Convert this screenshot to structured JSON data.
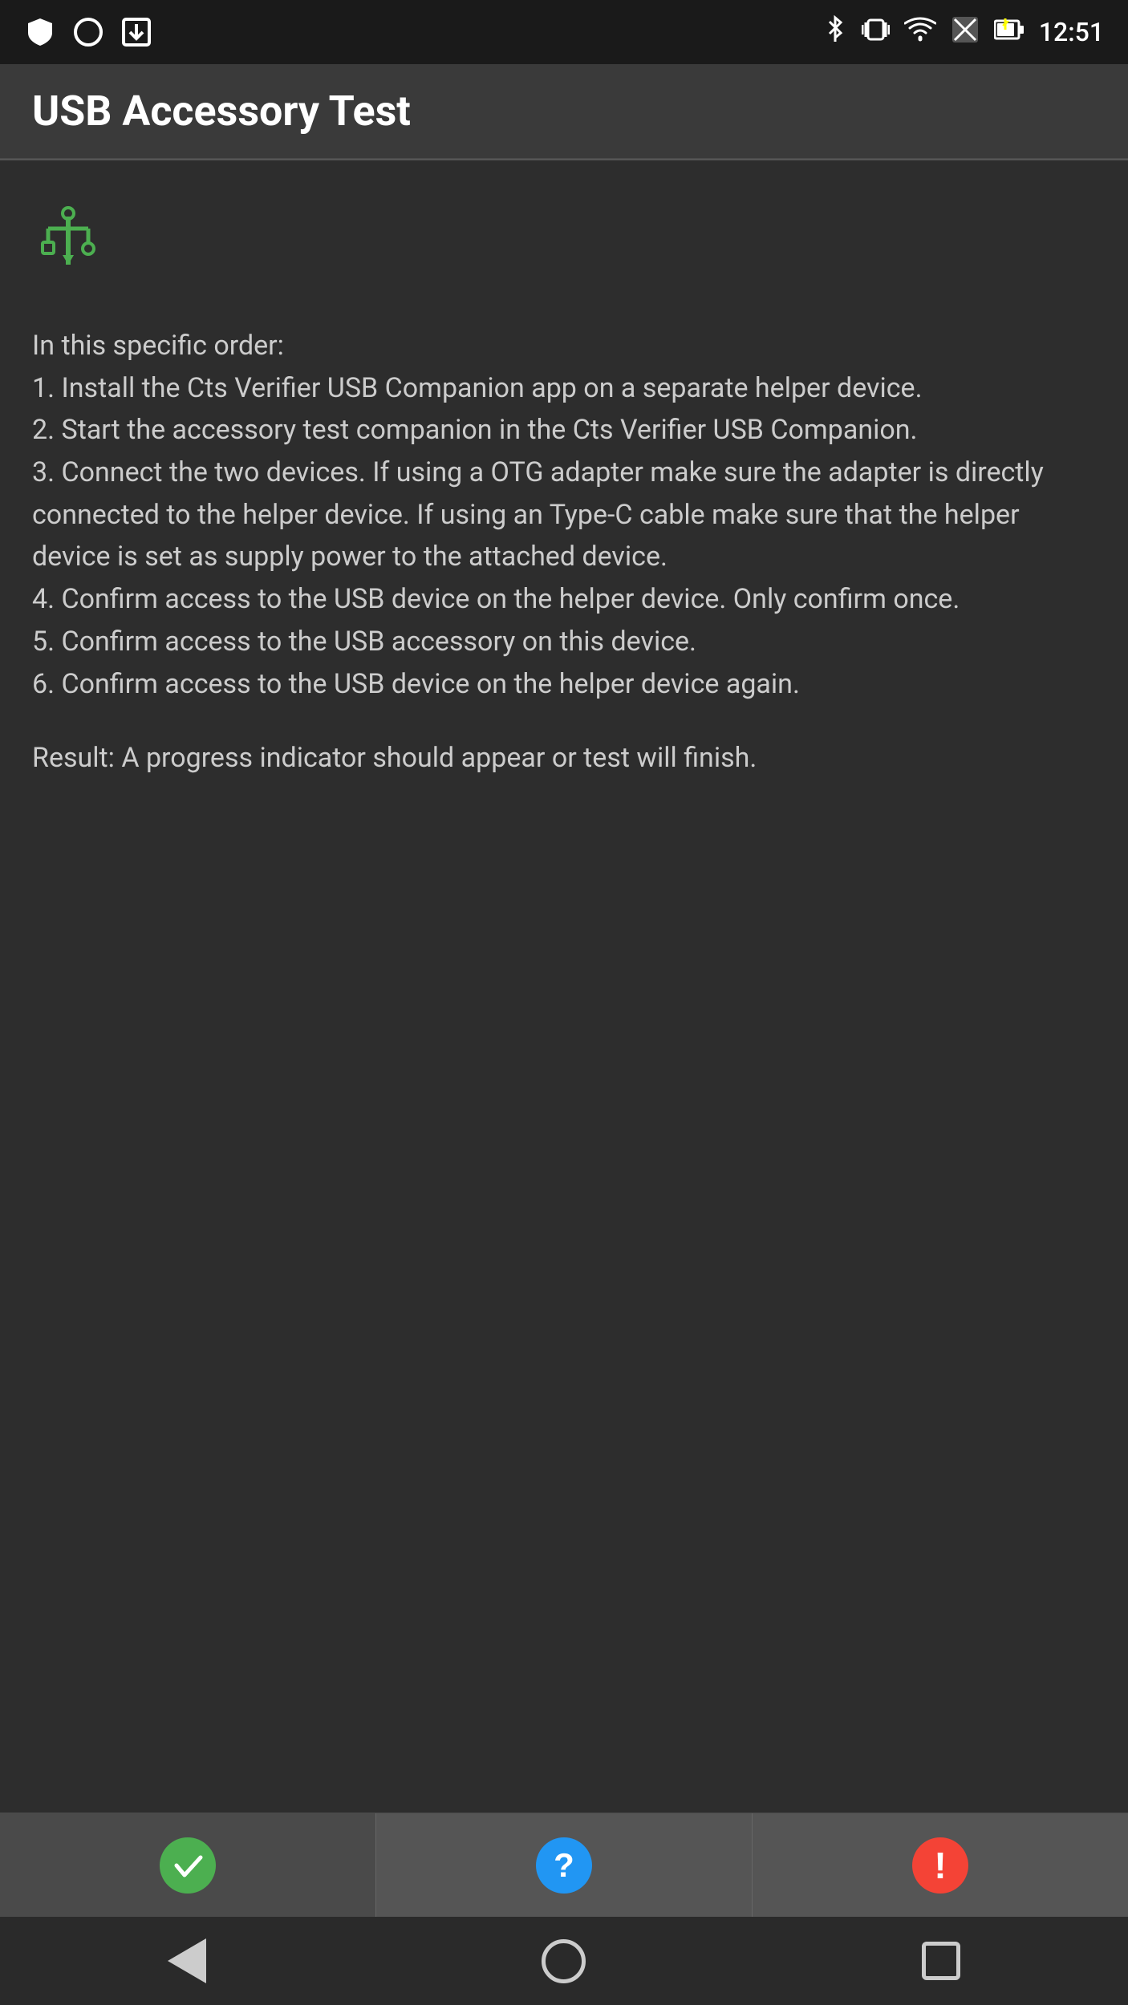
{
  "statusBar": {
    "time": "12:51",
    "icons": {
      "bluetooth": "bluetooth-icon",
      "vibrate": "vibrate-icon",
      "wifi": "wifi-icon",
      "signal": "signal-icon",
      "battery": "battery-icon"
    }
  },
  "appBar": {
    "title": "USB Accessory Test"
  },
  "content": {
    "usbIcon": "✦",
    "instructions": "In this specific order:\n1. Install the Cts Verifier USB Companion app on a separate helper device.\n2. Start the accessory test companion in the Cts Verifier USB Companion.\n3. Connect the two devices. If using a OTG adapter make sure the adapter is directly connected to the helper device. If using an Type-C cable make sure that the helper device is set as supply power to the attached device.\n4. Confirm access to the USB device on the helper device. Only confirm once.\n5. Confirm access to the USB accessory on this device.\n6. Confirm access to the USB device on the helper device again.",
    "result": "Result: A progress indicator should appear or test will finish."
  },
  "bottomBar": {
    "successIcon": "✓",
    "infoIcon": "?",
    "warningIcon": "!"
  },
  "navBar": {
    "backLabel": "back",
    "homeLabel": "home",
    "recentLabel": "recent"
  }
}
